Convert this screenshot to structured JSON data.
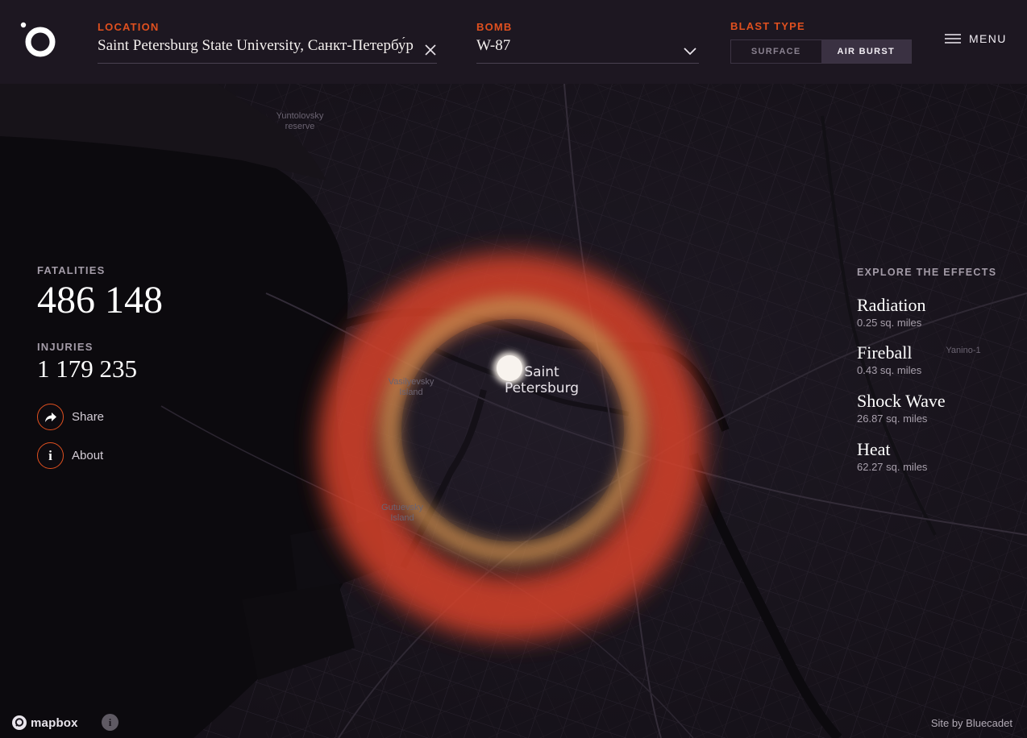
{
  "header": {
    "location_label": "LOCATION",
    "location_value": "Saint Petersburg State University, Санкт-Петербу́ргский",
    "bomb_label": "BOMB",
    "bomb_value": "W-87",
    "blast_type_label": "BLAST TYPE",
    "blast_options": [
      "SURFACE",
      "AIR BURST"
    ],
    "blast_selected": "AIR BURST",
    "menu_label": "MENU"
  },
  "map": {
    "labels": {
      "yuntolovsky": "Yuntolovsky\nreserve",
      "vasilyevsky": "Vasilyevsky\nIsland",
      "gutuevsky": "Gutuevsky\nIsland",
      "yanino": "Yanino-1"
    },
    "city_label": "Saint Petersburg"
  },
  "stats": {
    "fatalities_label": "FATALITIES",
    "fatalities_value": "486 148",
    "injuries_label": "INJURIES",
    "injuries_value": "1 179 235"
  },
  "actions": {
    "share_label": "Share",
    "about_label": "About"
  },
  "effects": {
    "title": "EXPLORE THE EFFECTS",
    "items": [
      {
        "name": "Radiation",
        "area": "0.25 sq. miles"
      },
      {
        "name": "Fireball",
        "area": "0.43 sq. miles"
      },
      {
        "name": "Shock Wave",
        "area": "26.87 sq. miles"
      },
      {
        "name": "Heat",
        "area": "62.27 sq. miles"
      }
    ]
  },
  "footer": {
    "mapbox_text": "mapbox",
    "credit": "Site by Bluecadet"
  },
  "colors": {
    "accent": "#e0501f",
    "header_bg": "#1d1721",
    "heat_ring": "#d8432c",
    "shock_ring": "#c98a4e"
  }
}
